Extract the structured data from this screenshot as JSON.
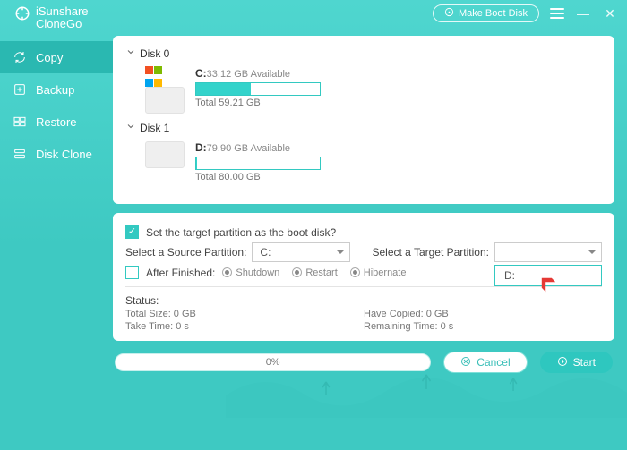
{
  "brand": {
    "line1": "iSunshare",
    "line2": "CloneGo"
  },
  "topbar": {
    "make_boot_label": "Make Boot Disk"
  },
  "sidebar": {
    "items": [
      {
        "label": "Copy"
      },
      {
        "label": "Backup"
      },
      {
        "label": "Restore"
      },
      {
        "label": "Disk Clone"
      }
    ]
  },
  "disks": [
    {
      "header": "Disk 0",
      "letter": "C:",
      "available": "33.12 GB Available",
      "total": "Total 59.21 GB",
      "fill_pct": 44,
      "is_system": true
    },
    {
      "header": "Disk 1",
      "letter": "D:",
      "available": "79.90 GB Available",
      "total": "Total 80.00 GB",
      "fill_pct": 1,
      "is_system": false
    }
  ],
  "settings": {
    "boot_checkbox_label": "Set the target partition as the boot disk?",
    "boot_checked": true,
    "source_label": "Select a Source Partition:",
    "source_value": "C:",
    "target_label": "Select a Target Partition:",
    "target_value": "",
    "after_finished_label": "After Finished:",
    "after_checked": false,
    "after_options": [
      "Shutdown",
      "Restart",
      "Hibernate"
    ],
    "target_dropdown_options": [
      "D:"
    ]
  },
  "status": {
    "title": "Status:",
    "total_size": "Total Size: 0 GB",
    "have_copied": "Have Copied: 0 GB",
    "take_time": "Take Time: 0 s",
    "remaining_time": "Remaining Time: 0 s"
  },
  "footer": {
    "progress_text": "0%",
    "cancel_label": "Cancel",
    "start_label": "Start"
  },
  "colors": {
    "accent": "#33c9c1"
  }
}
